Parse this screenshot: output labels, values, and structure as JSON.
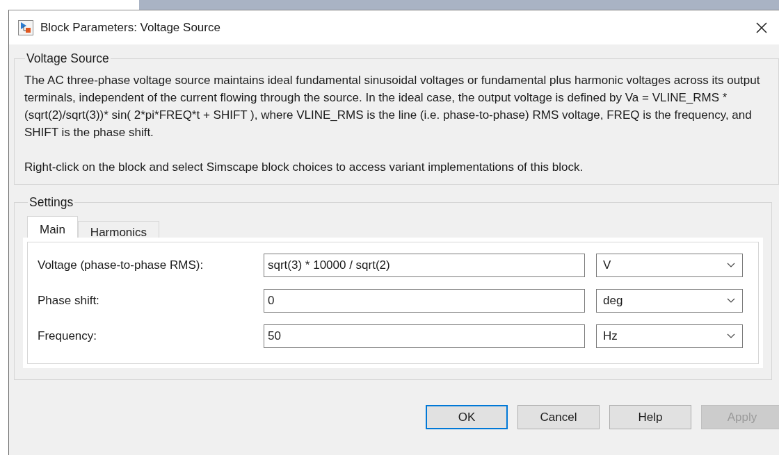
{
  "window": {
    "title": "Block Parameters: Voltage Source"
  },
  "description_group": {
    "title": "Voltage Source",
    "paragraphs": [
      "The AC three-phase voltage source maintains ideal fundamental sinusoidal voltages or fundamental plus harmonic voltages across its output terminals, independent of the current flowing through the source. In the ideal case, the output voltage is defined by Va = VLINE_RMS * (sqrt(2)/sqrt(3))* sin( 2*pi*FREQ*t + SHIFT ), where VLINE_RMS is the line (i.e. phase-to-phase) RMS voltage, FREQ is the frequency, and SHIFT is the phase shift.",
      "Right-click on the block and select Simscape block choices to access variant implementations of this block."
    ]
  },
  "settings": {
    "title": "Settings",
    "tabs": [
      {
        "label": "Main",
        "selected": true
      },
      {
        "label": "Harmonics",
        "selected": false
      }
    ],
    "parameters": [
      {
        "label": "Voltage (phase-to-phase RMS):",
        "value": "sqrt(3) * 10000 / sqrt(2)",
        "unit": "V"
      },
      {
        "label": "Phase shift:",
        "value": "0",
        "unit": "deg"
      },
      {
        "label": "Frequency:",
        "value": "50",
        "unit": "Hz"
      }
    ]
  },
  "buttons": [
    {
      "label": "OK",
      "default": true,
      "disabled": false
    },
    {
      "label": "Cancel",
      "default": false,
      "disabled": false
    },
    {
      "label": "Help",
      "default": false,
      "disabled": false
    },
    {
      "label": "Apply",
      "default": false,
      "disabled": true
    }
  ]
}
